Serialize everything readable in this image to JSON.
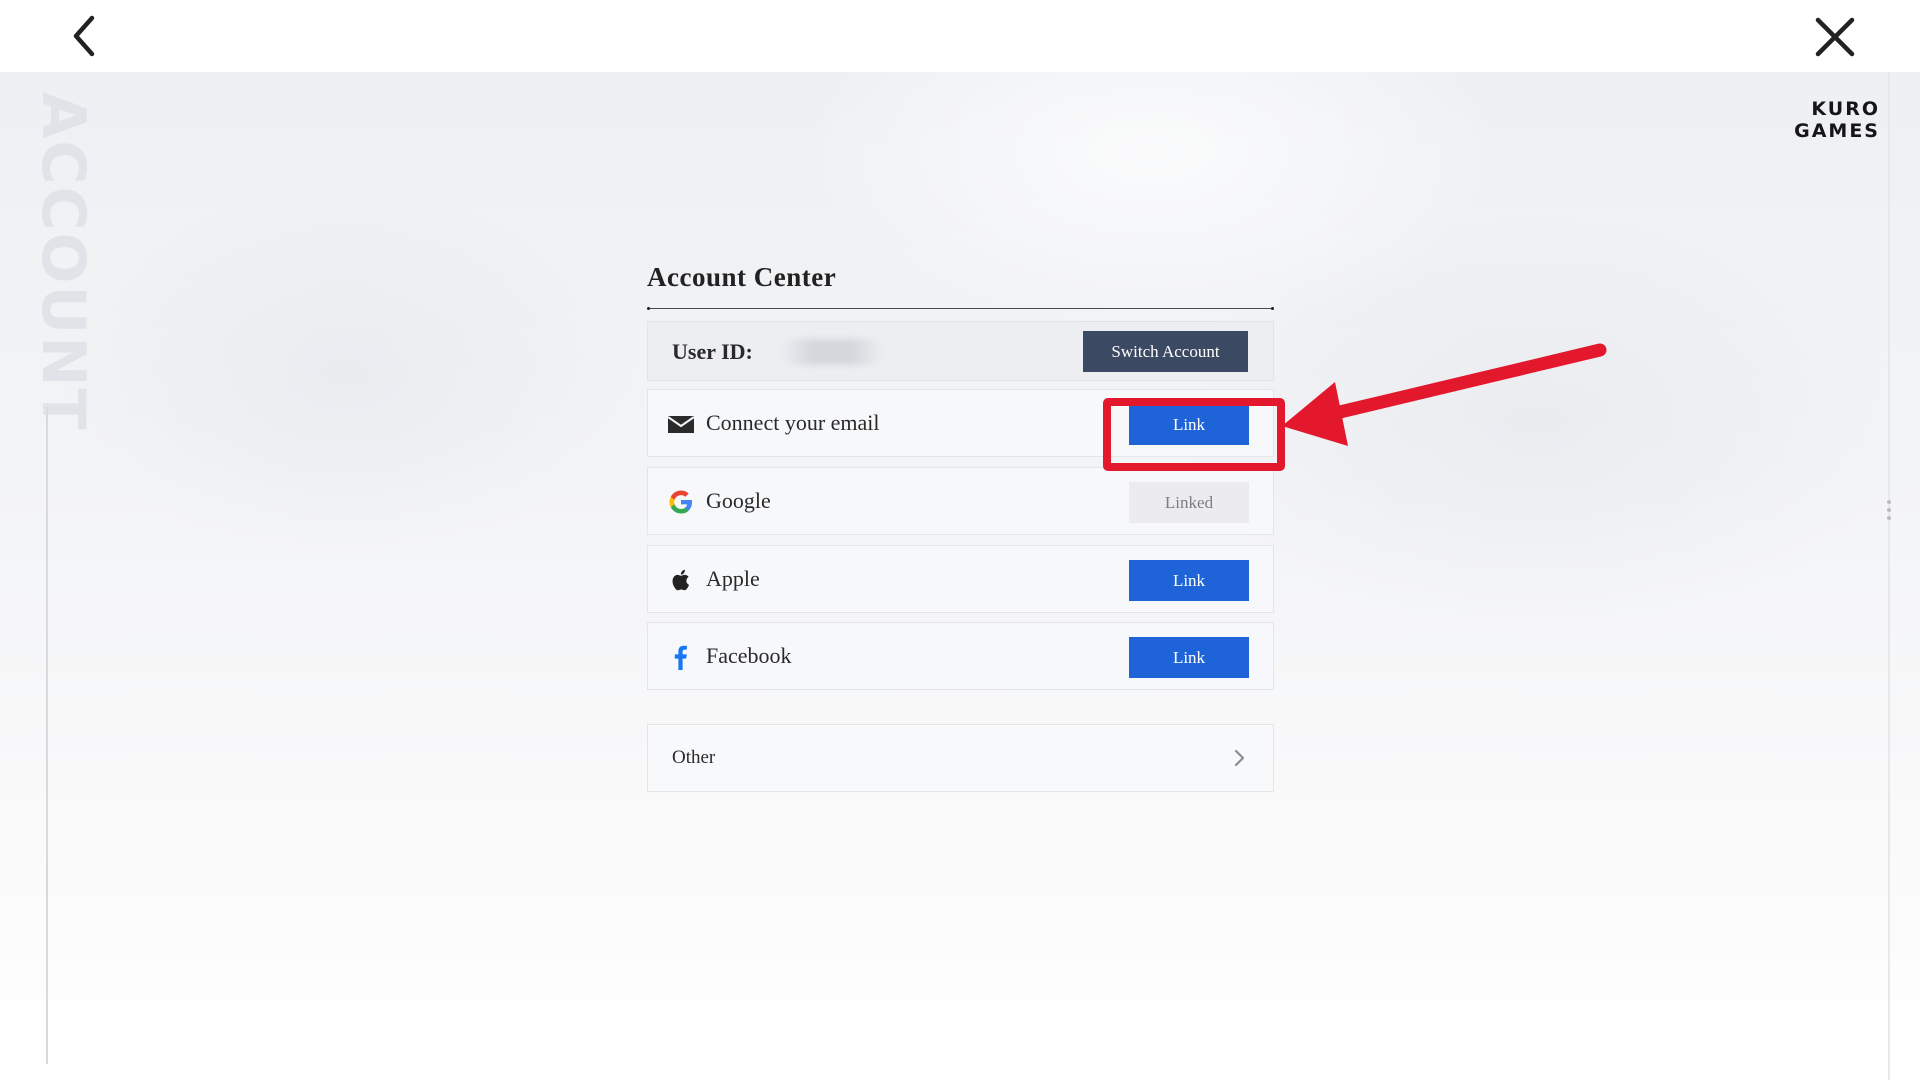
{
  "header": {
    "brand": "KURO GAMES",
    "side_label": "ACCOUNT"
  },
  "panel": {
    "title": "Account Center",
    "user_id_label": "User ID:",
    "user_id_value": "",
    "switch_label": "Switch Account",
    "rows": [
      {
        "label": "Connect your email",
        "icon": "mail-icon",
        "status": "Link"
      },
      {
        "label": "Google",
        "icon": "google-icon",
        "status": "Linked"
      },
      {
        "label": "Apple",
        "icon": "apple-icon",
        "status": "Link"
      },
      {
        "label": "Facebook",
        "icon": "facebook-icon",
        "status": "Link"
      }
    ],
    "other_label": "Other"
  },
  "colors": {
    "link_button": "#1f63d8",
    "switch_button": "#3b4962",
    "linked_button": "#ececee",
    "annotation": "#e4182d"
  }
}
